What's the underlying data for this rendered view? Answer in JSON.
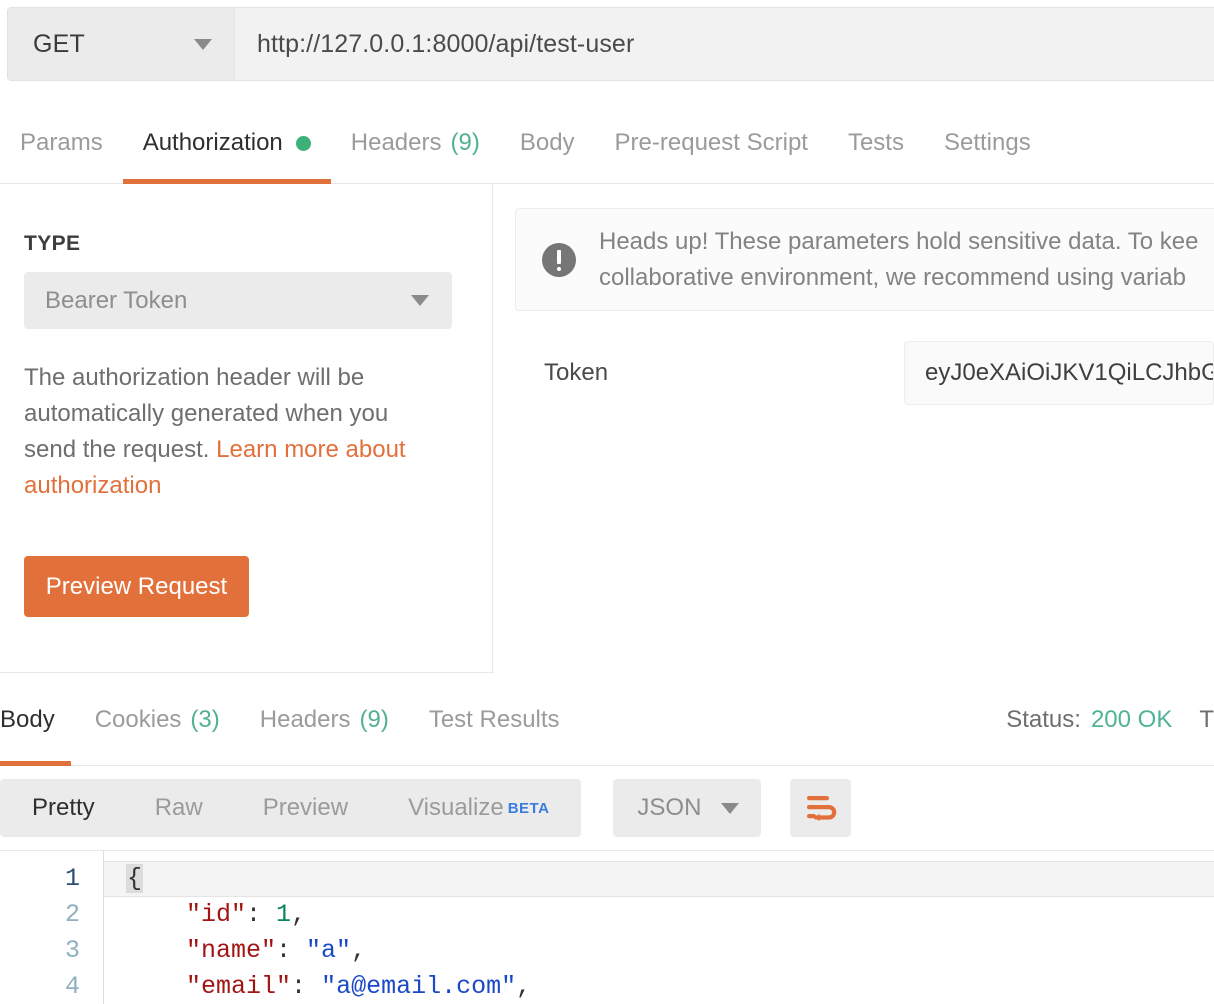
{
  "request": {
    "method": "GET",
    "url": "http://127.0.0.1:8000/api/test-user",
    "method_caret": "chevron-down-icon"
  },
  "request_tabs": [
    {
      "label": "Params",
      "count": "",
      "active": false,
      "dot": false
    },
    {
      "label": "Authorization",
      "count": "",
      "active": true,
      "dot": true
    },
    {
      "label": "Headers",
      "count": "(9)",
      "active": false,
      "dot": false
    },
    {
      "label": "Body",
      "count": "",
      "active": false,
      "dot": false
    },
    {
      "label": "Pre-request Script",
      "count": "",
      "active": false,
      "dot": false
    },
    {
      "label": "Tests",
      "count": "",
      "active": false,
      "dot": false
    },
    {
      "label": "Settings",
      "count": "",
      "active": false,
      "dot": false
    }
  ],
  "auth": {
    "type_heading": "TYPE",
    "type_value": "Bearer Token",
    "description_prefix": "The authorization header will be automatically generated when you send the request. ",
    "description_link": "Learn more about authorization",
    "preview_button": "Preview Request",
    "warning": "Heads up! These parameters hold sensitive data. To kee collaborative environment, we recommend using variab",
    "warning_line1": "Heads up! These parameters hold sensitive data. To kee",
    "warning_line2": "collaborative environment, we recommend using variab",
    "token_label": "Token",
    "token_value": "eyJ0eXAiOiJKV1QiLCJhbG"
  },
  "response_tabs": [
    {
      "label": "Body",
      "count": "",
      "active": true
    },
    {
      "label": "Cookies",
      "count": "(3)",
      "active": false
    },
    {
      "label": "Headers",
      "count": "(9)",
      "active": false
    },
    {
      "label": "Test Results",
      "count": "",
      "active": false
    }
  ],
  "response_status": {
    "status_label": "Status:",
    "status_value": "200 OK",
    "time_label": "T"
  },
  "viewer": {
    "modes": [
      {
        "label": "Pretty",
        "active": true,
        "beta": ""
      },
      {
        "label": "Raw",
        "active": false,
        "beta": ""
      },
      {
        "label": "Preview",
        "active": false,
        "beta": ""
      },
      {
        "label": "Visualize",
        "active": false,
        "beta": "BETA"
      }
    ],
    "format": "JSON",
    "wrap_icon": "wrap-text-icon"
  },
  "code": {
    "lines": [
      {
        "number": "1",
        "selected": true,
        "tokens": [
          {
            "text": "{",
            "type": "brace-selected"
          }
        ]
      },
      {
        "number": "2",
        "selected": false,
        "tokens": [
          {
            "text": "    ",
            "type": "plain"
          },
          {
            "text": "\"id\"",
            "type": "key"
          },
          {
            "text": ": ",
            "type": "punc"
          },
          {
            "text": "1",
            "type": "num"
          },
          {
            "text": ",",
            "type": "punc"
          }
        ]
      },
      {
        "number": "3",
        "selected": false,
        "tokens": [
          {
            "text": "    ",
            "type": "plain"
          },
          {
            "text": "\"name\"",
            "type": "key"
          },
          {
            "text": ": ",
            "type": "punc"
          },
          {
            "text": "\"a\"",
            "type": "str"
          },
          {
            "text": ",",
            "type": "punc"
          }
        ]
      },
      {
        "number": "4",
        "selected": false,
        "tokens": [
          {
            "text": "    ",
            "type": "plain"
          },
          {
            "text": "\"email\"",
            "type": "key"
          },
          {
            "text": ": ",
            "type": "punc"
          },
          {
            "text": "\"a@email.com\"",
            "type": "str"
          },
          {
            "text": ",",
            "type": "punc"
          }
        ]
      }
    ]
  },
  "colors": {
    "accent_orange": "#e2703a",
    "status_green": "#51b396",
    "dot_green": "#3cb179",
    "beta_blue": "#3b7ddd",
    "control_gray": "#ebebeb"
  }
}
